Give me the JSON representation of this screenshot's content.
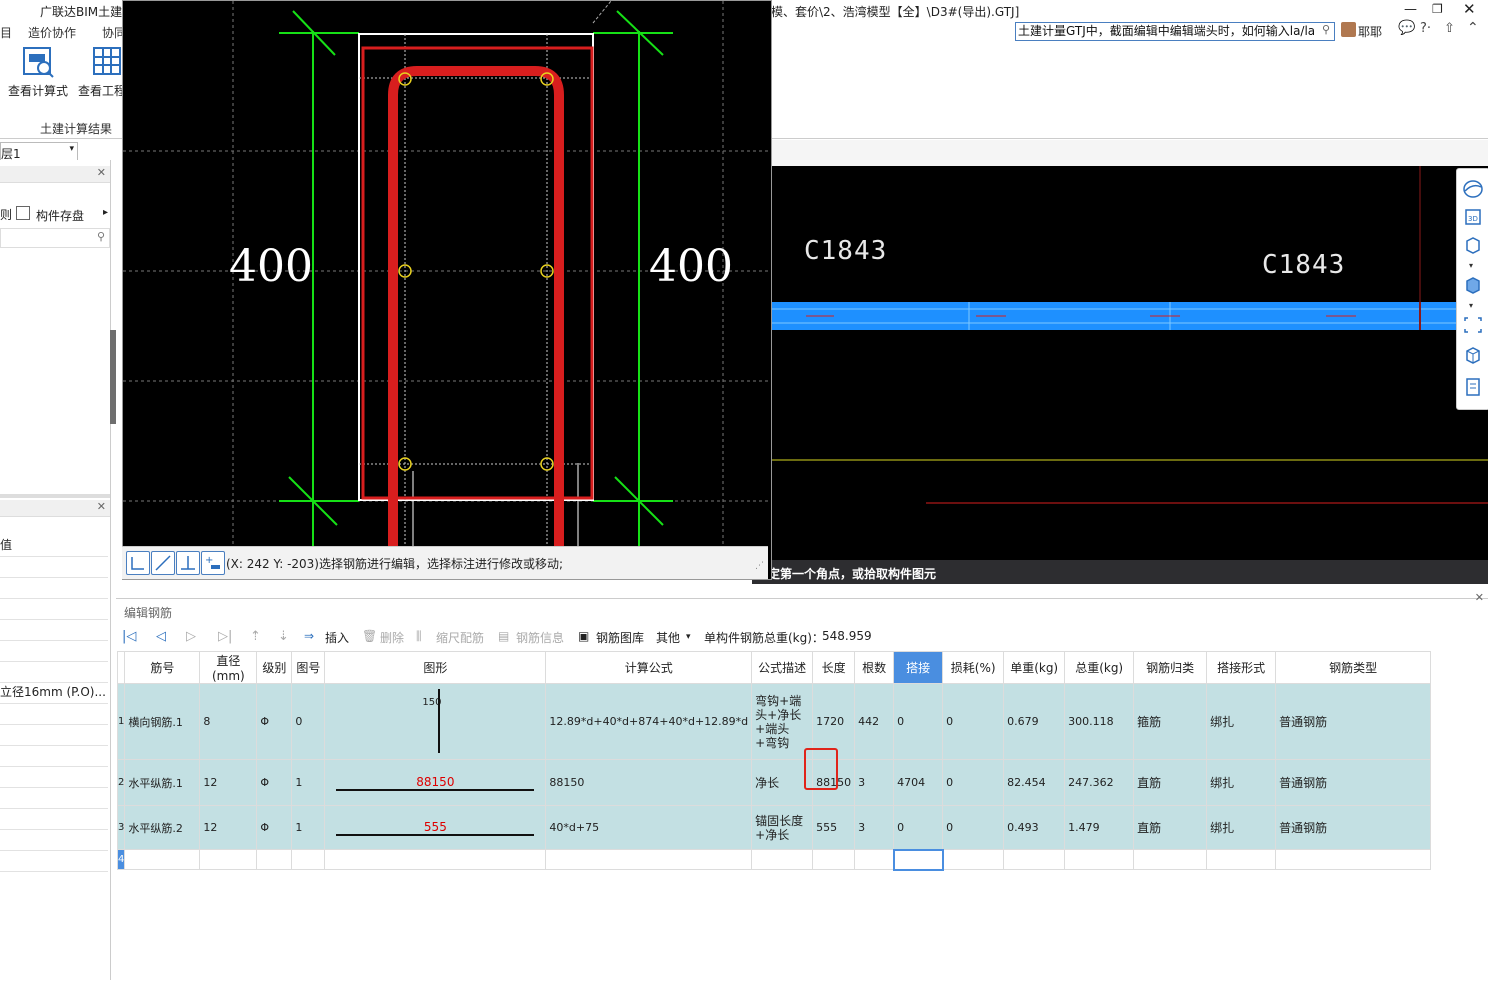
{
  "title": {
    "app_left": "广联达BIM土建",
    "path_right": "模、套价\\2、浩湾模型【全】\\D3#(导出).GTJ]"
  },
  "menu": {
    "items": [
      "造价协作",
      "协同"
    ]
  },
  "ribbon": {
    "view_formula": "查看计算式",
    "view_project": "查看工程",
    "group_label": "土建计算结果"
  },
  "search": {
    "value": "土建计量GTJ中，截面编辑中编辑端头时，如何输入la/la"
  },
  "user": {
    "name": "耶耶"
  },
  "floor_select": {
    "value": "层1"
  },
  "left_panel": {
    "tab_component_save": "构件存盘",
    "tab_prev": "则",
    "prop_header": "值",
    "prop_value": "立径16mm (P.O)..."
  },
  "popup": {
    "dim_left": "400",
    "dim_right": "400",
    "status_text": "(X: 242 Y: -203)选择钢筋进行编辑，选择标注进行修改或移动;"
  },
  "cad": {
    "label_1": "C1843",
    "label_2": "C1843",
    "command_text": "定第一个角点，或拾取构件图元"
  },
  "rebar_panel": {
    "title": "编辑钢筋",
    "insert": "插入",
    "delete": "删除",
    "scale_rebar": "缩尺配筋",
    "rebar_info": "钢筋信息",
    "rebar_library": "钢筋图库",
    "other": "其他",
    "total_weight_label": "单构件钢筋总重(kg)：",
    "total_weight_value": "548.959"
  },
  "table": {
    "headers": [
      "筋号",
      "直径(mm)",
      "级别",
      "图号",
      "图形",
      "计算公式",
      "公式描述",
      "长度",
      "根数",
      "搭接",
      "损耗(%)",
      "单重(kg)",
      "总重(kg)",
      "钢筋归类",
      "搭接形式",
      "钢筋类型"
    ],
    "rows": [
      {
        "num": "1",
        "name": "横向钢筋.1",
        "dia": "8",
        "grade": "Φ",
        "fig": "0",
        "shape": "150",
        "formula": "12.89*d+40*d+874+40*d+12.89*d",
        "desc": "弯钩+端头+净长+端头+弯钩",
        "len": "1720",
        "count": "442",
        "lap": "0",
        "loss": "0",
        "unit": "0.679",
        "total": "300.118",
        "cat": "箍筋",
        "lap_type": "绑扎",
        "type": "普通钢筋"
      },
      {
        "num": "2",
        "name": "水平纵筋.1",
        "dia": "12",
        "grade": "Φ",
        "fig": "1",
        "shape": "88150",
        "formula": "88150",
        "desc": "净长",
        "len": "88150",
        "count": "3",
        "lap": "4704",
        "loss": "0",
        "unit": "82.454",
        "total": "247.362",
        "cat": "直筋",
        "lap_type": "绑扎",
        "type": "普通钢筋"
      },
      {
        "num": "3",
        "name": "水平纵筋.2",
        "dia": "12",
        "grade": "Φ",
        "fig": "1",
        "shape": "555",
        "formula": "40*d+75",
        "desc": "锚固长度+净长",
        "len": "555",
        "count": "3",
        "lap": "0",
        "loss": "0",
        "unit": "0.493",
        "total": "1.479",
        "cat": "直筋",
        "lap_type": "绑扎",
        "type": "普通钢筋"
      }
    ],
    "empty_row_num": "4"
  },
  "colors": {
    "rebar_red": "#d81e1e",
    "dim_green": "#16e016",
    "beam_blue": "#1e90ff",
    "row_bg": "#c3e0e3",
    "highlight_header": "#4a8ee0"
  }
}
